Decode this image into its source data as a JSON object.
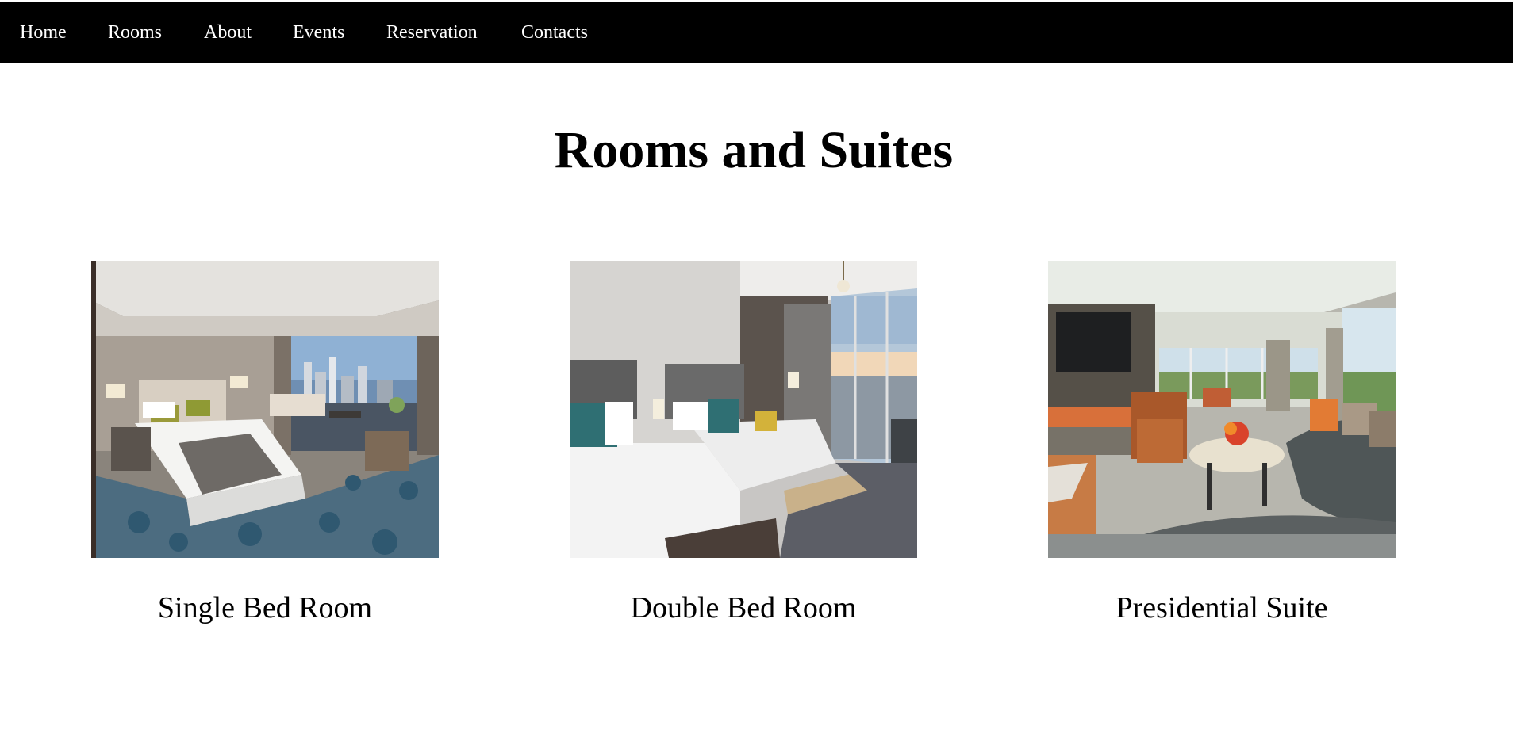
{
  "nav": {
    "items": [
      {
        "label": "Home"
      },
      {
        "label": "Rooms"
      },
      {
        "label": "About"
      },
      {
        "label": "Events"
      },
      {
        "label": "Reservation"
      },
      {
        "label": "Contacts"
      }
    ]
  },
  "main": {
    "title": "Rooms and Suites",
    "rooms": [
      {
        "name": "Single Bed Room"
      },
      {
        "name": "Double Bed Room"
      },
      {
        "name": "Presidential Suite"
      }
    ]
  },
  "colors": {
    "nav_background": "#000000",
    "nav_text": "#ffffff",
    "page_background": "#ffffff",
    "text": "#000000"
  }
}
